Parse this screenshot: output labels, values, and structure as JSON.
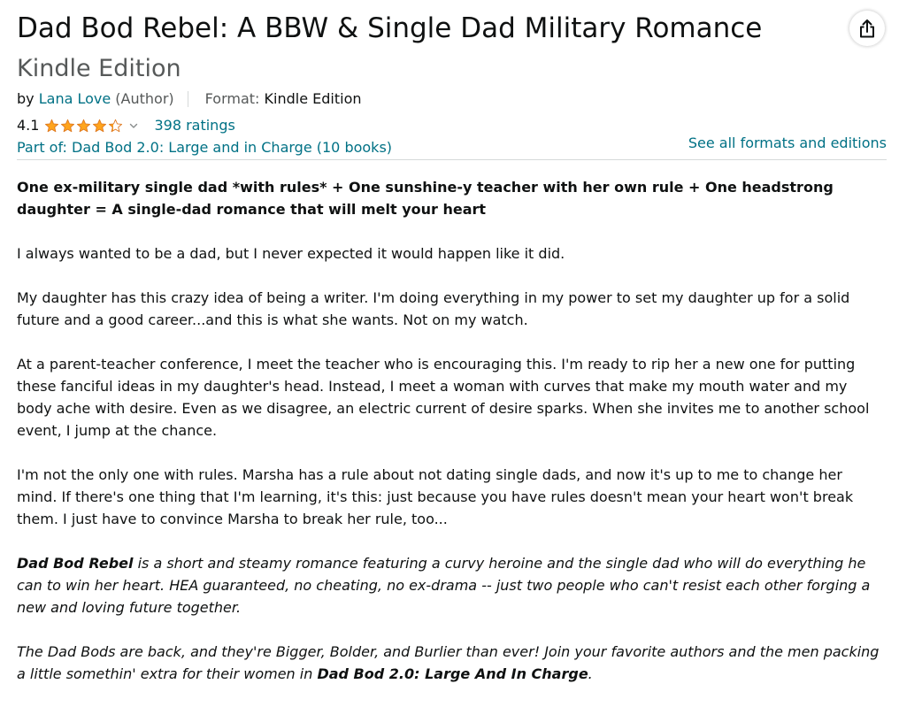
{
  "product": {
    "title": "Dad Bod Rebel: A BBW & Single Dad Military Romance",
    "subtitle": "Kindle Edition"
  },
  "byline": {
    "by": "by",
    "author": "Lana Love",
    "role": "(Author)",
    "format_label": "Format:",
    "format_value": "Kindle Edition"
  },
  "rating": {
    "value": "4.1",
    "stars": 4.1,
    "count_text": "398 ratings",
    "star_color": "#ffa41c"
  },
  "series": {
    "text": "Part of: Dad Bod 2.0: Large and in Charge (10 books)",
    "formats_link": "See all formats and editions"
  },
  "share": {
    "icon": "share-icon"
  },
  "colors": {
    "link": "#007185",
    "text": "#0f1111",
    "muted": "#565959",
    "divider": "#d5d9d9"
  },
  "description": {
    "lead": "One ex-military single dad *with rules* + One sunshine-y teacher with her own rule + One headstrong daughter = A single-dad romance that will melt your heart",
    "p1": "I always wanted to be a dad, but I never expected it would happen like it did.",
    "p2": "My daughter has this crazy idea of being a writer. I'm doing everything in my power to set my daughter up for a solid future and a good career...and this is what she wants. Not on my watch.",
    "p3": "At a parent-teacher conference, I meet the teacher who is encouraging this. I'm ready to rip her a new one for putting these fanciful ideas in my daughter's head. Instead, I meet a woman with curves that make my mouth water and my body ache with desire. Even as we disagree, an electric current of desire sparks. When she invites me to another school event, I jump at the chance.",
    "p4": "I'm not the only one with rules. Marsha has a rule about not dating single dads, and now it's up to me to change her mind. If there's one thing that I'm learning, it's this: just because you have rules doesn't mean your heart won't break them. I just have to convince Marsha to break her rule, too...",
    "p5_bold": "Dad Bod Rebel",
    "p5_rest": " is a short and steamy romance featuring a curvy heroine and the single dad who will do everything he can to win her heart. HEA guaranteed, no cheating, no ex-drama -- just two people who can't resist each other forging a new and loving future together.",
    "p6_start": "The Dad Bods are back, and they're Bigger, Bolder, and Burlier than ever! Join your favorite authors and the men packing a little somethin' extra for their women in ",
    "p6_bold": "Dad Bod 2.0: Large And In Charge",
    "p6_end": "."
  }
}
